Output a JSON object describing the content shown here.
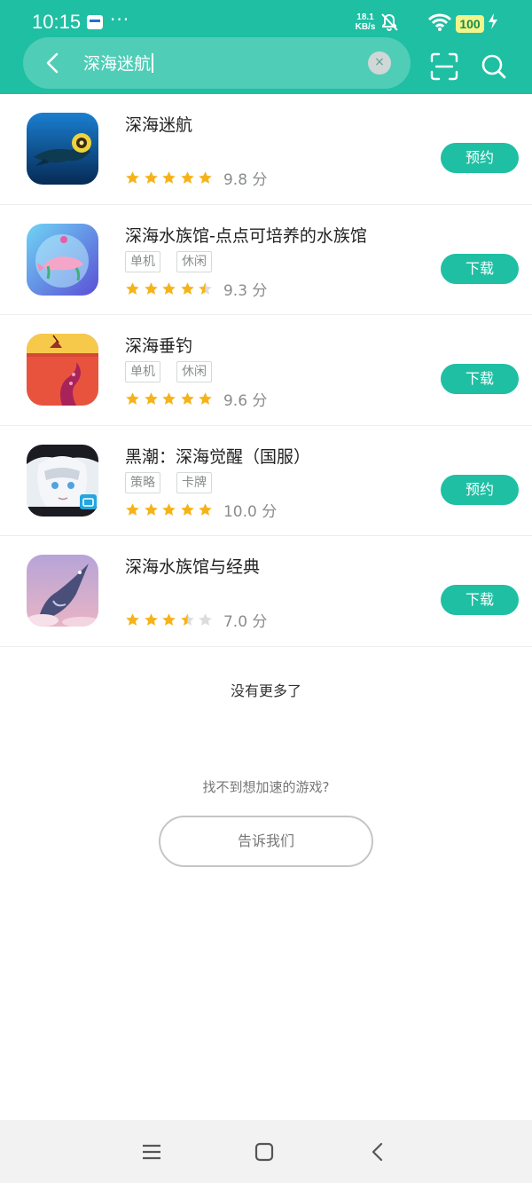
{
  "status_bar": {
    "time": "10:15",
    "more_dots": "···",
    "speed_value": "18.1",
    "speed_unit": "KB/s",
    "battery": "100",
    "icons": [
      "notifications-icon",
      "mute-icon",
      "wifi-icon",
      "charging-icon"
    ]
  },
  "search": {
    "query": "深海迷航",
    "clear_symbol": "×",
    "icons": [
      "back-icon",
      "clear-icon",
      "scan-icon",
      "search-icon"
    ]
  },
  "colors": {
    "brand": "#1fbfa3",
    "star": "#f5b319",
    "star_empty": "#dcdcdc"
  },
  "games": [
    {
      "name": "深海迷航",
      "tags": [],
      "rating": 5,
      "score_text": "9.8 分",
      "action": "预约"
    },
    {
      "name": "深海水族馆-点点可培养的水族馆",
      "tags": [
        "单机",
        "休闲"
      ],
      "rating": 4.5,
      "score_text": "9.3 分",
      "action": "下载"
    },
    {
      "name": "深海垂钓",
      "tags": [
        "单机",
        "休闲"
      ],
      "rating": 5,
      "score_text": "9.6 分",
      "action": "下载"
    },
    {
      "name": "黑潮：深海觉醒（国服）",
      "tags": [
        "策略",
        "卡牌"
      ],
      "rating": 5,
      "score_text": "10.0 分",
      "action": "预约"
    },
    {
      "name": "深海水族馆与经典",
      "tags": [],
      "rating": 3.5,
      "score_text": "7.0 分",
      "action": "下载"
    }
  ],
  "footer": {
    "no_more": "没有更多了",
    "not_found_prompt": "找不到想加速的游戏?",
    "tell_us": "告诉我们"
  },
  "nav_bar": {
    "icons": [
      "menu-icon",
      "home-icon",
      "back-icon"
    ]
  }
}
